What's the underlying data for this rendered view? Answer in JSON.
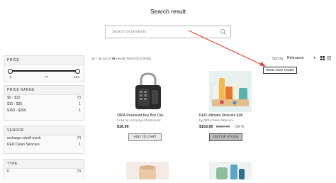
{
  "page": {
    "title": "Search result"
  },
  "search": {
    "placeholder": "Search for products",
    "icon": "search-icon"
  },
  "filters": {
    "price": {
      "title": "PRICE",
      "slider_labels": [
        "1",
        "77",
        "153"
      ],
      "selected_range": [
        1,
        153
      ]
    },
    "price_range": {
      "title": "PRICE RANGE",
      "options": [
        {
          "label": "$0 - $10",
          "count": "73"
        },
        {
          "label": "$10 - $25",
          "count": "1"
        },
        {
          "label": "$150 - $200",
          "count": "1"
        }
      ]
    },
    "vendor": {
      "title": "VENDOR",
      "options": [
        {
          "label": "recharge-crbn8-mock",
          "count": "74"
        },
        {
          "label": "REN Clean Skincare",
          "count": "1"
        }
      ]
    },
    "type": {
      "title": "TYPE",
      "options": [
        {
          "label": "0",
          "count": "73"
        }
      ]
    }
  },
  "results": {
    "range": "25 - 36",
    "out_of": "out of",
    "total": "75",
    "found_text": "results found",
    "time": "(in 0.003s)"
  },
  "sort": {
    "label": "Sort by",
    "value": "Relevance"
  },
  "show_more": {
    "label": "Show more results"
  },
  "products": [
    {
      "title": "ORIA Password Key Box Out...",
      "vendor": "locks by recharge-crbn8-mock",
      "price": "$16.59",
      "old_price": "",
      "discount": "",
      "button": "ADD TO CART"
    },
    {
      "title": "REN Ultimate Skincare Edit",
      "vendor": "by REN Clean Skincare",
      "price": "$153.00",
      "old_price": "$382.00",
      "discount": "- 59 %",
      "button": "OUT OF STOCK"
    }
  ],
  "colors": {
    "arrow": "#e8402a",
    "accent_text": "#111111"
  }
}
